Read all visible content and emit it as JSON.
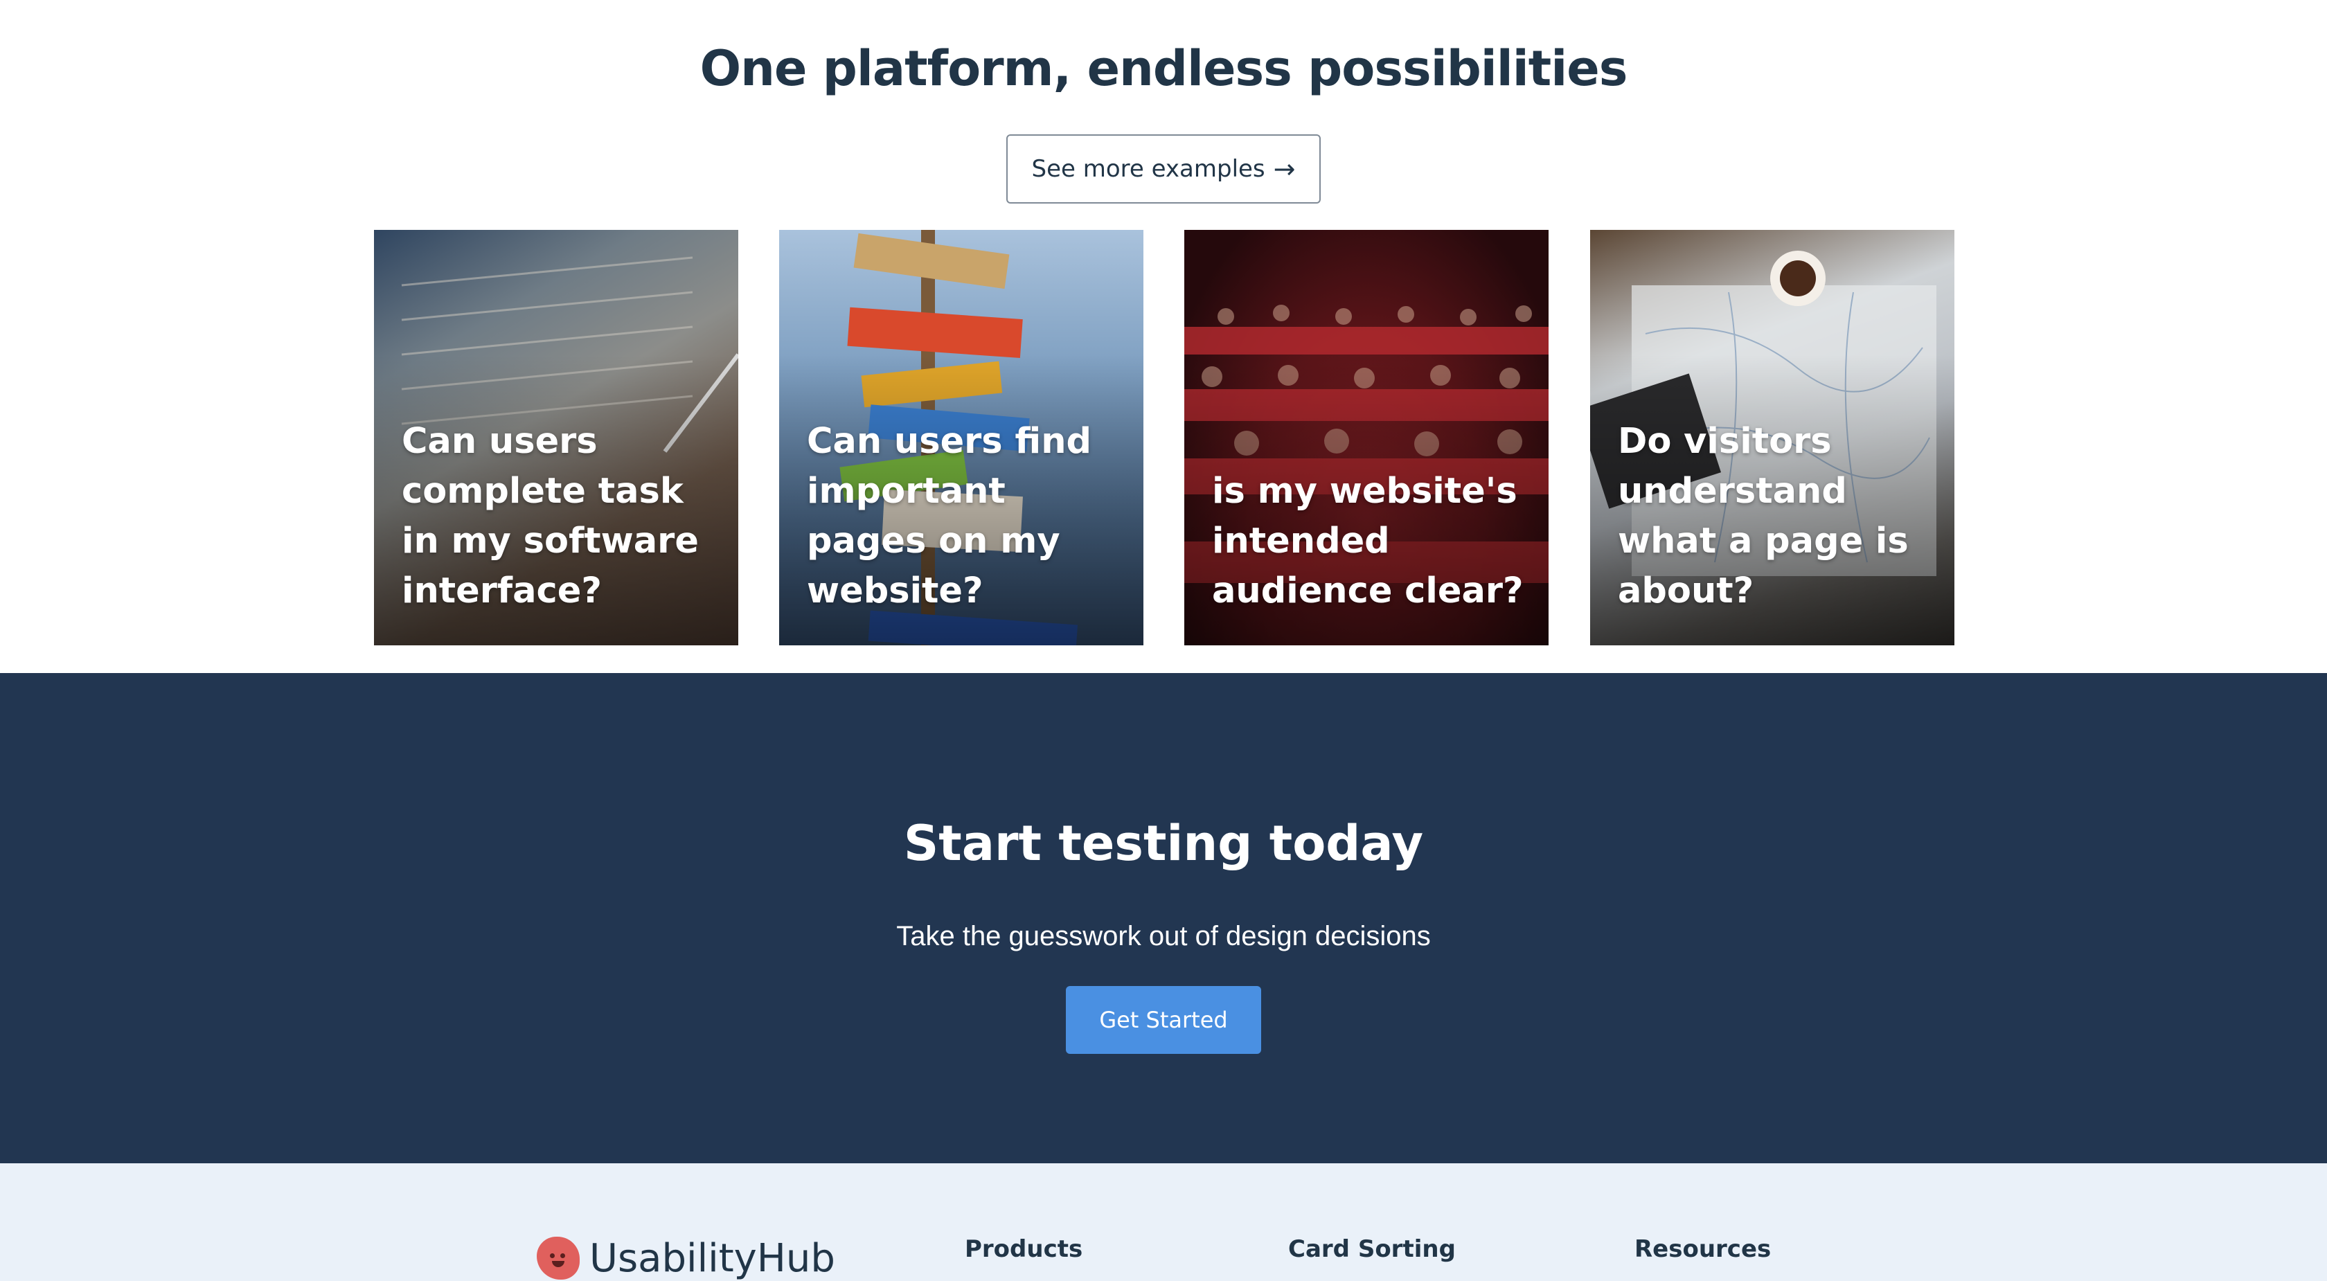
{
  "examples": {
    "heading": "One platform, endless possibilities",
    "more_button": "See more examples",
    "cards": [
      {
        "title": "Can users complete task in my software interface?"
      },
      {
        "title": "Can users find important pages on my website?"
      },
      {
        "title": "is my website's intended audience clear?"
      },
      {
        "title": "Do visitors understand what a page is about?"
      }
    ]
  },
  "cta": {
    "heading": "Start testing today",
    "subheading": "Take the guesswork out of design decisions",
    "button": "Get Started",
    "accent_color": "#4a90e2",
    "background_color": "#223651"
  },
  "footer": {
    "logo_text": "UsabilityHub",
    "logo_color": "#e0605d",
    "columns": [
      "Products",
      "Card Sorting",
      "Resources"
    ]
  }
}
